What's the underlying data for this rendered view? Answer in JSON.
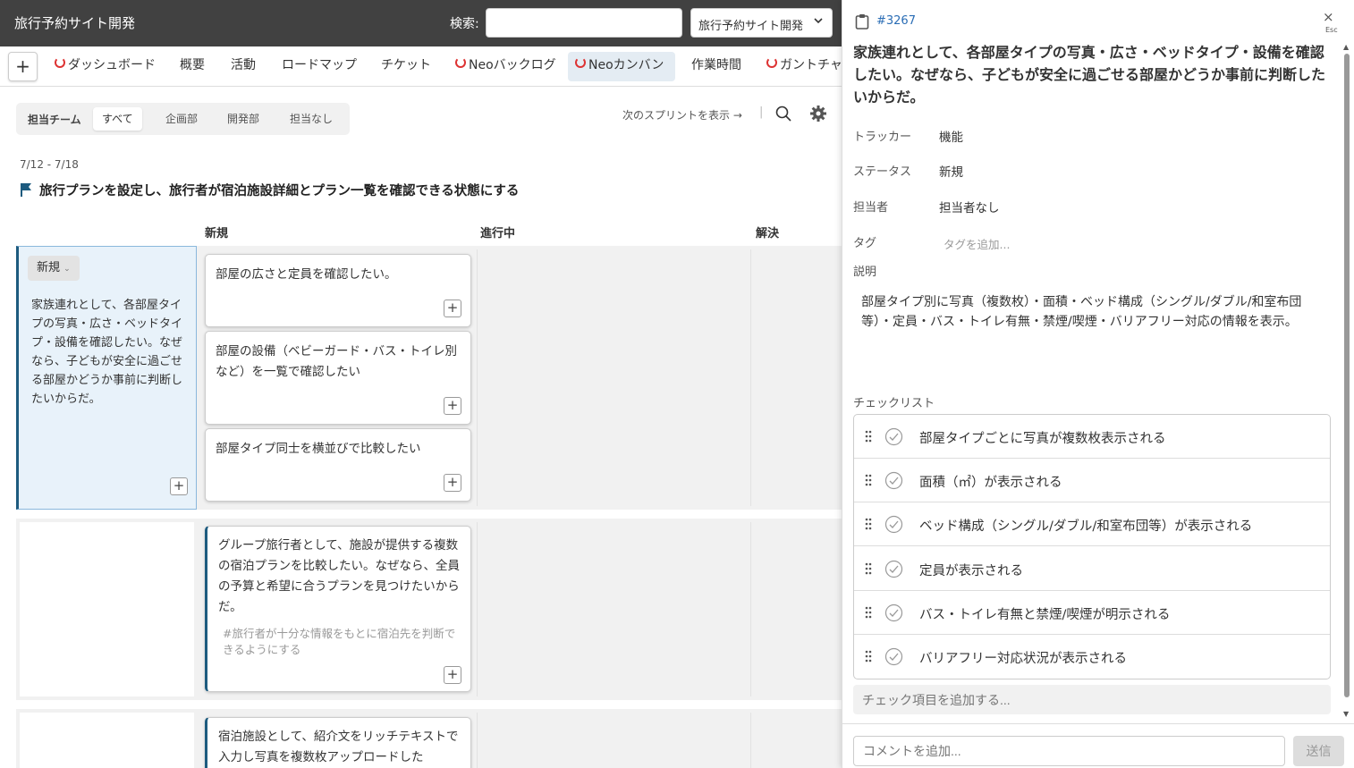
{
  "header": {
    "title": "旅行予約サイト開発",
    "search_label": "検索:",
    "search_value": "",
    "project_select": "旅行予約サイト開発"
  },
  "menu": {
    "add_label": "+",
    "items": [
      "ダッシュボード",
      "概要",
      "活動",
      "ロードマップ",
      "チケット",
      "Neoバックログ",
      "Neoカンバン",
      "作業時間",
      "ガントチャート"
    ],
    "active": "Neoカンバン"
  },
  "filter": {
    "label": "担当チーム",
    "options": [
      "すべて",
      "企画部",
      "開発部",
      "担当なし"
    ],
    "selected": "すべて"
  },
  "toolbar": {
    "next_sprint": "次のスプリントを表示 →"
  },
  "sprint": {
    "dates": "7/12 - 7/18",
    "goal": "旅行プランを設定し、旅行者が宿泊施設詳細とプラン一覧を確認できる状態にする"
  },
  "columns": [
    "新規",
    "進行中",
    "解決"
  ],
  "stories": [
    {
      "status": "新規",
      "text": "家族連れとして、各部屋タイプの写真・広さ・ベッドタイプ・設備を確認したい。なぜなら、子どもが安全に過ごせる部屋かどうか事前に判断したいからだ。",
      "cards": [
        "部屋の広さと定員を確認したい。",
        "部屋の設備（ベビーガード・バス・トイレ別など）を一覧で確認したい",
        "部屋タイプ同士を横並びで比較したい"
      ]
    },
    {
      "card_text": "グループ旅行者として、施設が提供する複数の宿泊プランを比較したい。なぜなら、全員の予算と希望に合うプランを見つけたいからだ。",
      "card_tag": "#旅行者が十分な情報をもとに宿泊先を判断できるようにする"
    },
    {
      "card_text": "宿泊施設として、紹介文をリッチテキストで入力し写真を複数枚アップロードした"
    }
  ],
  "detail": {
    "id": "#3267",
    "close": "×",
    "esc": "Esc",
    "title": "家族連れとして、各部屋タイプの写真・広さ・ベッドタイプ・設備を確認したい。なぜなら、子どもが安全に過ごせる部屋かどうか事前に判断したいからだ。",
    "fields": [
      {
        "label": "トラッカー",
        "value": "機能"
      },
      {
        "label": "ステータス",
        "value": "新規"
      },
      {
        "label": "担当者",
        "value": "担当者なし"
      }
    ],
    "tag_label": "タグ",
    "tag_placeholder": "タグを追加...",
    "desc_label": "説明",
    "description": "部屋タイプ別に写真（複数枚）・面積・ベッド構成（シングル/ダブル/和室布団等）・定員・バス・トイレ有無・禁煙/喫煙・バリアフリー対応の情報を表示。",
    "checklist_label": "チェックリスト",
    "checklist": [
      "部屋タイプごとに写真が複数枚表示される",
      "面積（㎡）が表示される",
      "ベッド構成（シングル/ダブル/和室布団等）が表示される",
      "定員が表示される",
      "バス・トイレ有無と禁煙/喫煙が明示される",
      "バリアフリー対応状況が表示される"
    ],
    "checklist_add_placeholder": "チェック項目を追加する...",
    "comment_placeholder": "コメントを追加...",
    "send_label": "送信"
  },
  "colors": {
    "topbar": "#414141",
    "accent": "#1d5b7f",
    "link": "#2a6db5",
    "neo_icon": "#dd3333"
  }
}
